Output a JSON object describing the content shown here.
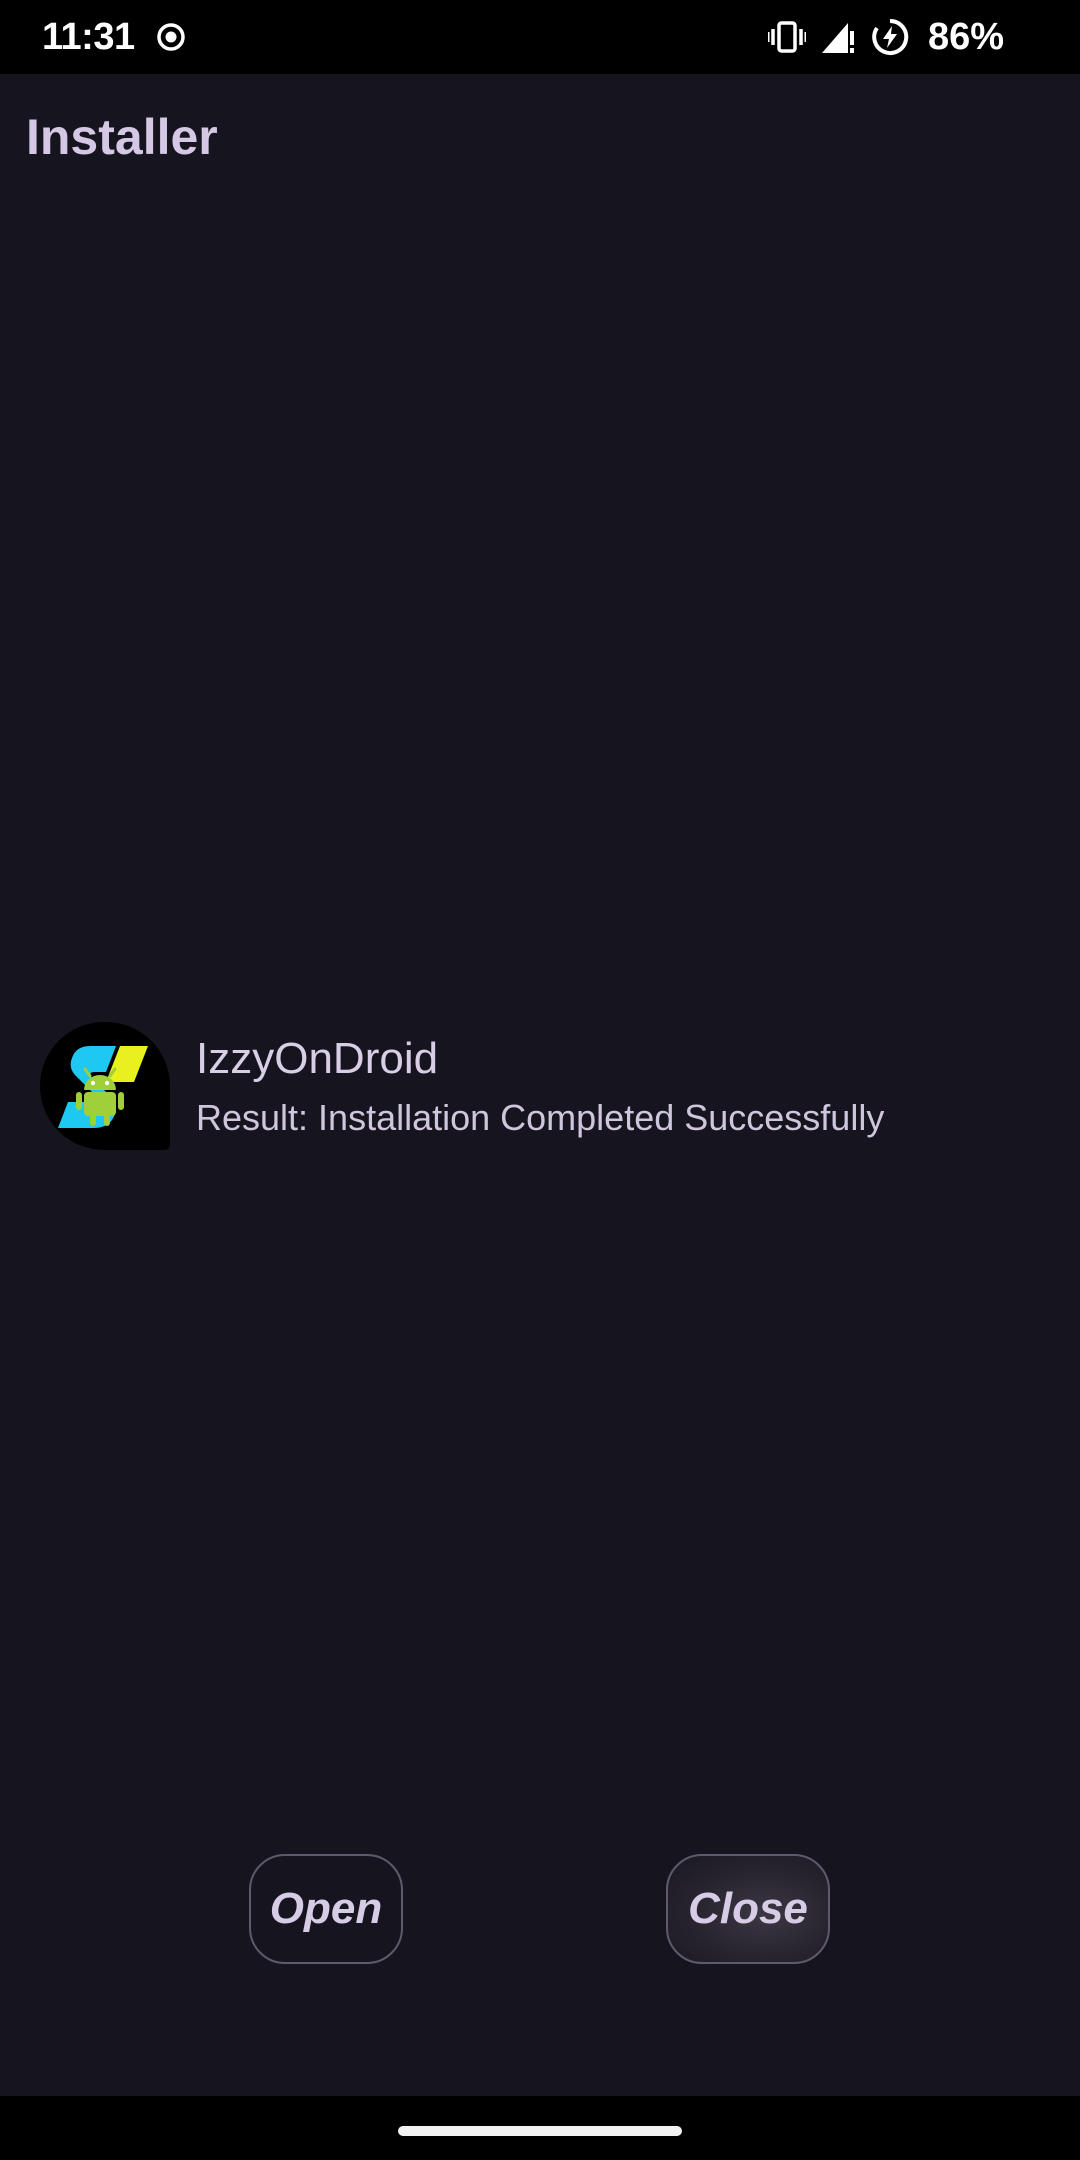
{
  "status_bar": {
    "time": "11:31",
    "battery_percent": "86%",
    "icons": [
      "record-icon",
      "vibrate-icon",
      "signal-icon",
      "battery-charging-icon"
    ]
  },
  "app_bar": {
    "title": "Installer"
  },
  "result": {
    "app_name": "IzzyOnDroid",
    "message": "Result: Installation Completed Successfully",
    "app_icon": "izzyondroid-app-icon"
  },
  "actions": {
    "open_label": "Open",
    "close_label": "Close"
  },
  "colors": {
    "background": "#16141e",
    "title_text": "#d4c8e4",
    "button_border": "#5f5a69",
    "icon_cyan": "#1ec8f0",
    "icon_yellow": "#e8f01e",
    "android_green": "#9fd03a"
  }
}
